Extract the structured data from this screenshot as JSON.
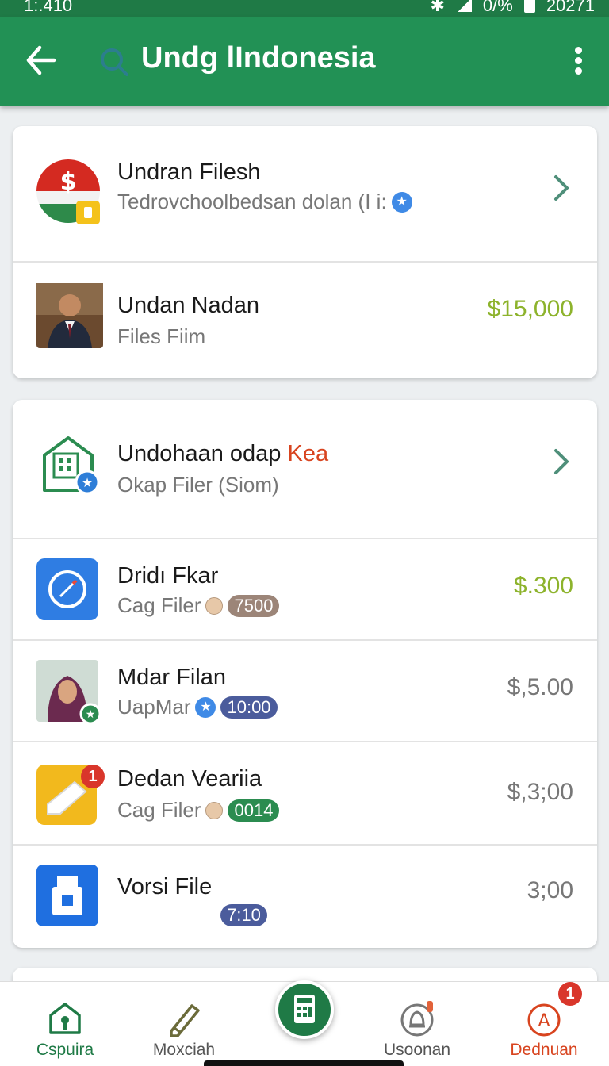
{
  "status_bar": {
    "time": "1:.410",
    "battery": "0/%",
    "right_text": "20271"
  },
  "header": {
    "title": "Undg lIndonesia"
  },
  "list1": {
    "items": [
      {
        "title": "Undran Filesh",
        "subtitle": "Tedrovchoolbedsan dolan (I i:",
        "icon": "flag-dollar-icon"
      },
      {
        "title": "Undan Nadan",
        "subtitle": "Files Fiim",
        "price": "$15,000",
        "icon": "man-portrait-avatar"
      }
    ]
  },
  "list2": {
    "items": [
      {
        "title_main": "Undohaan odap",
        "title_accent": "Kea",
        "subtitle": "Okap Filer (Siom)",
        "icon": "building-icon"
      },
      {
        "title": "Dridı Fkar",
        "subtitle": "Cag Filer",
        "badge": "7500",
        "price": "$.300",
        "icon": "compass-app-icon"
      },
      {
        "title": "Mdar Filan",
        "subtitle": "UapMar",
        "badge": "10:00",
        "price": "$,5.00",
        "icon": "woman-portrait-avatar"
      },
      {
        "title": "Dedan Veariia",
        "subtitle": "Cag Filer",
        "badge": "0014",
        "price": "$,3;00",
        "notification": "1",
        "icon": "notes-app-icon"
      },
      {
        "title": "Vorsi File",
        "badge": "7:10",
        "price": "3;00",
        "icon": "usb-app-icon"
      }
    ]
  },
  "bottom_nav": {
    "items": [
      {
        "label": "Cspuira",
        "icon": "home-lock-icon",
        "color": "#1f7a46"
      },
      {
        "label": "Moxciah",
        "icon": "pen-icon",
        "color": "#555555"
      },
      {
        "label": "Usoonan",
        "icon": "bell-icon",
        "color": "#555555"
      },
      {
        "label": "Dednuan",
        "icon": "triangle-alert-icon",
        "color": "#d8441f",
        "notification": "1"
      }
    ],
    "fab_icon": "calculator-icon"
  },
  "colors": {
    "primary": "#229155",
    "price_green": "#8db32c",
    "accent_red": "#d8441f"
  }
}
